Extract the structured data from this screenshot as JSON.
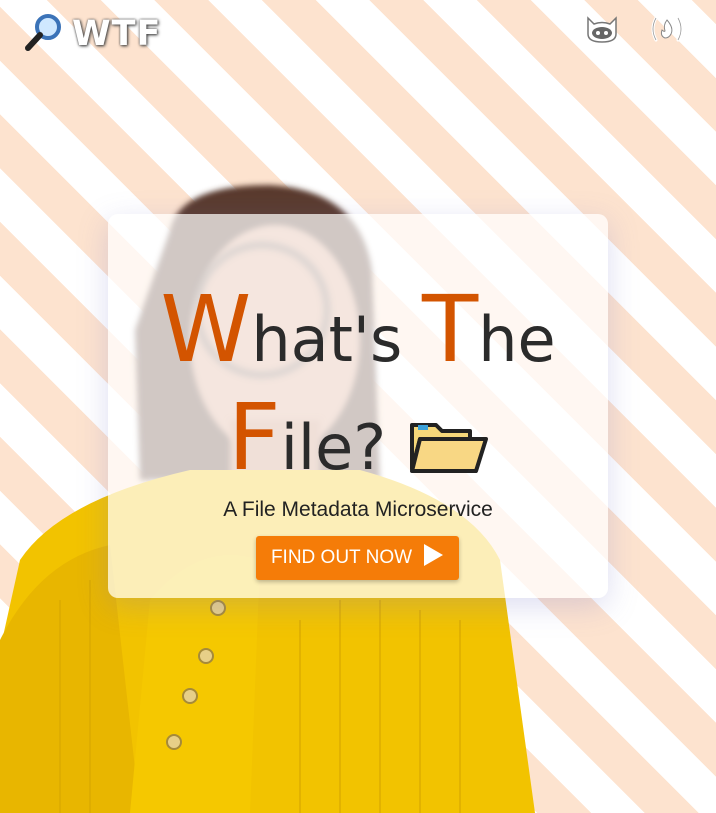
{
  "header": {
    "brand_title": "WTF",
    "brand_icon": "magnifying-glass-icon",
    "nav_icons": [
      "github-icon",
      "freecodecamp-icon"
    ]
  },
  "hero": {
    "title_line1": {
      "cap1": "W",
      "rest1": "hat's ",
      "cap2": "T",
      "rest2": "he"
    },
    "title_line2": {
      "cap": "F",
      "rest": "ile?"
    },
    "title_icon": "folder-icon",
    "subtitle": "A File Metadata Microservice",
    "cta_label": "FIND OUT NOW",
    "cta_icon": "play-icon"
  },
  "colors": {
    "accent": "#d35400",
    "button": "#f57c08",
    "stripe": "#fde3cf",
    "sweater": "#f2c300"
  }
}
